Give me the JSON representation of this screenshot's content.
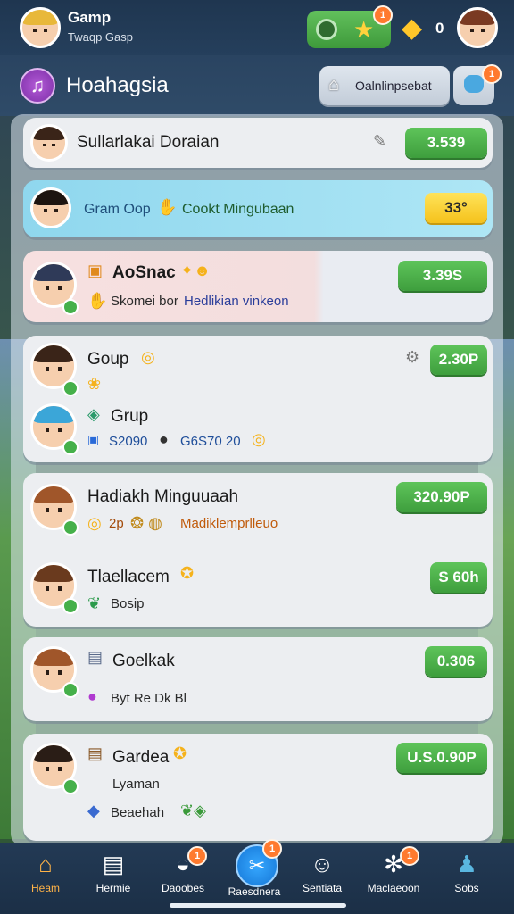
{
  "user": {
    "name": "Gamp",
    "sub": "Twaqp  Gasp"
  },
  "top": {
    "badge_count": "1",
    "coins": "0"
  },
  "group": {
    "title": "Hoahagsia",
    "action_label": "Oalnlinpsebat",
    "chat_badge": "1"
  },
  "list": [
    {
      "name": "Sullarlakai Doraian",
      "price": "3.539"
    },
    {
      "name": "Gram Oop",
      "sub": "Cookt Mingubaan",
      "price": "33°"
    },
    {
      "name": "AoSnac",
      "sub1": "Skomei bor",
      "sub2": "Hedlikian vinkeon",
      "price": "3.39S"
    },
    {
      "name": "Goup",
      "price": "2.30P"
    },
    {
      "name": "Grup",
      "sub": "S2090",
      "sub2": "G6S70 20"
    },
    {
      "name": "Hadiakh Minguuaah",
      "sub1": "2p",
      "sub2": "Madiklemprlleuo",
      "price": "320.90P"
    },
    {
      "name": "Tlaellacem",
      "sub": "Bosip",
      "price": "S 60h"
    },
    {
      "name": "Goelkak",
      "sub": "Byt Re Dk Bl",
      "price": "0.306"
    },
    {
      "name": "Gardea",
      "sub1": "Lyaman",
      "sub2": "Beaehah",
      "price": "U.S.0.90P"
    }
  ],
  "nav": [
    {
      "label": "Heam",
      "icon": "home-icon"
    },
    {
      "label": "Hermie",
      "icon": "store-icon"
    },
    {
      "label": "Daoobes",
      "icon": "bag-icon",
      "badge": "1"
    },
    {
      "label": "Raesdnera",
      "icon": "tools-icon",
      "badge": "1"
    },
    {
      "label": "Sentiata",
      "icon": "person-icon"
    },
    {
      "label": "Maclaeoon",
      "icon": "network-icon",
      "badge": "1"
    },
    {
      "label": "Sobs",
      "icon": "profile-icon"
    }
  ]
}
